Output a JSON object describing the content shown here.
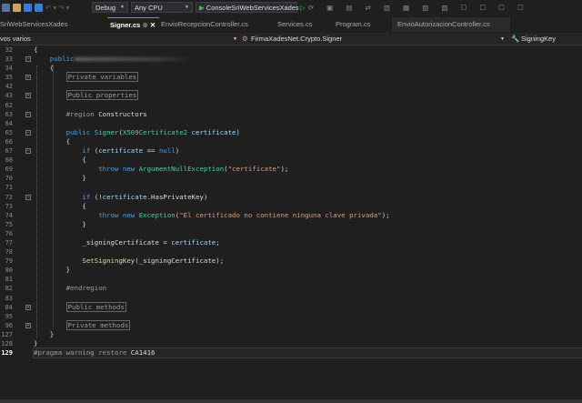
{
  "toolbar": {
    "config": "Debug",
    "platform": "Any CPU",
    "run_target": "ConsoleSriWebServicesXades"
  },
  "tabs": [
    {
      "label": "SriWebServicesXades",
      "active": false
    },
    {
      "label": "Signer.cs",
      "active": true
    },
    {
      "label": "EnvioRecepcionController.cs",
      "active": false
    },
    {
      "label": "Services.cs",
      "active": false
    },
    {
      "label": "Program.cs",
      "active": false
    },
    {
      "label": "EnvioAutorizacionController.cs",
      "active": false
    }
  ],
  "navbar": {
    "project": "vos varios",
    "type": "FirmaXadesNet.Crypto.Signer",
    "member": "SigningKey"
  },
  "lines": [
    {
      "n": "32",
      "t": [
        [
          "cl",
          "{"
        ]
      ]
    },
    {
      "n": "33",
      "fold": "-",
      "t": [
        [
          "kw",
          "    public"
        ],
        [
          "blur",
          ""
        ]
      ]
    },
    {
      "n": "34",
      "t": [
        [
          "cl",
          "    {"
        ]
      ]
    },
    {
      "n": "35",
      "fold": "+",
      "t": [
        [
          "cl",
          "        "
        ],
        [
          "co",
          "Private variables"
        ]
      ]
    },
    {
      "n": "42",
      "t": []
    },
    {
      "n": "43",
      "fold": "+",
      "t": [
        [
          "cl",
          "        "
        ],
        [
          "co",
          "Public properties"
        ]
      ]
    },
    {
      "n": "62",
      "t": []
    },
    {
      "n": "63",
      "fold": "-",
      "t": [
        [
          "pp",
          "        #region "
        ],
        [
          "cl",
          "Constructors"
        ]
      ]
    },
    {
      "n": "64",
      "t": []
    },
    {
      "n": "65",
      "fold": "-",
      "t": [
        [
          "kw",
          "        public "
        ],
        [
          "ty",
          "Signer"
        ],
        [
          "cl",
          "("
        ],
        [
          "ty",
          "X509Certificate2"
        ],
        [
          "pa",
          " certificate"
        ],
        [
          "cl",
          ")"
        ]
      ]
    },
    {
      "n": "66",
      "t": [
        [
          "cl",
          "        {"
        ]
      ]
    },
    {
      "n": "67",
      "fold": "-",
      "t": [
        [
          "kw",
          "            if "
        ],
        [
          "cl",
          "("
        ],
        [
          "pa",
          "certificate"
        ],
        [
          "cl",
          " == "
        ],
        [
          "kw",
          "null"
        ],
        [
          "cl",
          ")"
        ]
      ]
    },
    {
      "n": "68",
      "t": [
        [
          "cl",
          "            {"
        ]
      ]
    },
    {
      "n": "69",
      "t": [
        [
          "kw",
          "                throw new "
        ],
        [
          "ty",
          "ArgumentNullException"
        ],
        [
          "cl",
          "("
        ],
        [
          "st",
          "\"certificate\""
        ],
        [
          "cl",
          ");"
        ]
      ]
    },
    {
      "n": "70",
      "t": [
        [
          "cl",
          "            }"
        ]
      ]
    },
    {
      "n": "71",
      "t": []
    },
    {
      "n": "72",
      "fold": "-",
      "t": [
        [
          "kw",
          "            if "
        ],
        [
          "cl",
          "(!"
        ],
        [
          "pa",
          "certificate"
        ],
        [
          "cl",
          ".HasPrivateKey)"
        ]
      ]
    },
    {
      "n": "73",
      "t": [
        [
          "cl",
          "            {"
        ]
      ]
    },
    {
      "n": "74",
      "t": [
        [
          "kw",
          "                throw new "
        ],
        [
          "ty",
          "Exception"
        ],
        [
          "cl",
          "("
        ],
        [
          "st",
          "\"El certificado no contiene ninguna clave privada\""
        ],
        [
          "cl",
          ");"
        ]
      ]
    },
    {
      "n": "75",
      "t": [
        [
          "cl",
          "            }"
        ]
      ]
    },
    {
      "n": "76",
      "t": []
    },
    {
      "n": "77",
      "t": [
        [
          "cl",
          "            _signingCertificate = "
        ],
        [
          "pa",
          "certificate"
        ],
        [
          "cl",
          ";"
        ]
      ]
    },
    {
      "n": "78",
      "t": []
    },
    {
      "n": "79",
      "t": [
        [
          "mt",
          "            SetSigningKey"
        ],
        [
          "cl",
          "(_signingCertificate);"
        ]
      ]
    },
    {
      "n": "80",
      "t": [
        [
          "cl",
          "        }"
        ]
      ]
    },
    {
      "n": "81",
      "t": []
    },
    {
      "n": "82",
      "t": [
        [
          "pp",
          "        #endregion"
        ]
      ]
    },
    {
      "n": "83",
      "t": []
    },
    {
      "n": "84",
      "fold": "+",
      "t": [
        [
          "cl",
          "        "
        ],
        [
          "co",
          "Public methods"
        ]
      ]
    },
    {
      "n": "95",
      "t": []
    },
    {
      "n": "96",
      "fold": "+",
      "t": [
        [
          "cl",
          "        "
        ],
        [
          "co",
          "Private methods"
        ]
      ]
    },
    {
      "n": "127",
      "t": [
        [
          "cl",
          "    }"
        ]
      ]
    },
    {
      "n": "128",
      "t": [
        [
          "cl",
          "}"
        ]
      ]
    },
    {
      "n": "129",
      "current": true,
      "t": [
        [
          "pp",
          "#pragma warning restore "
        ],
        [
          "cl",
          "CA1416"
        ]
      ]
    }
  ]
}
